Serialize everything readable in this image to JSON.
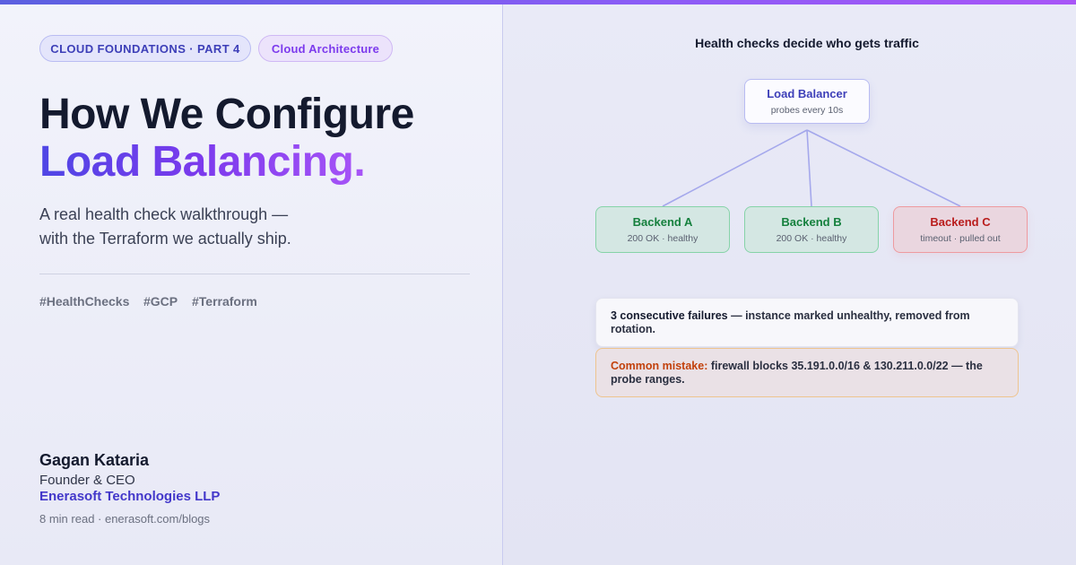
{
  "badges": {
    "series": "CLOUD FOUNDATIONS · PART 4",
    "topic": "Cloud Architecture"
  },
  "headline": {
    "line1": "How We Configure",
    "line2": "Load Balancing."
  },
  "subtitle": {
    "line1": "A real health check walkthrough —",
    "line2": "with the Terraform we actually ship."
  },
  "tags": [
    "#HealthChecks",
    "#GCP",
    "#Terraform"
  ],
  "author": {
    "name": "Gagan Kataria",
    "role": "Founder & CEO",
    "company": "Enerasoft Technologies LLP",
    "meta": "8 min read · enerasoft.com/blogs"
  },
  "diagram": {
    "title": "Health checks decide who gets traffic",
    "load_balancer": {
      "title": "Load Balancer",
      "subtitle": "probes every 10s"
    },
    "backends": [
      {
        "title": "Backend A",
        "status": "200 OK · healthy",
        "state": "healthy"
      },
      {
        "title": "Backend B",
        "status": "200 OK · healthy",
        "state": "healthy"
      },
      {
        "title": "Backend C",
        "status": "timeout · pulled out",
        "state": "unhealthy"
      }
    ]
  },
  "callouts": [
    {
      "lead": "3 consecutive failures",
      "text": " — instance marked unhealthy, removed from rotation."
    },
    {
      "lead": "Common mistake:",
      "text": " firewall blocks 35.191.0.0/16 & 130.211.0.0/22 — the probe ranges."
    }
  ],
  "colors": {
    "accent": "#4f46e5",
    "accent_purple": "#a855f7",
    "healthy": "#15803d",
    "unhealthy": "#b91c1c",
    "warning": "#c2410c",
    "connector": "#a5a8ec"
  }
}
